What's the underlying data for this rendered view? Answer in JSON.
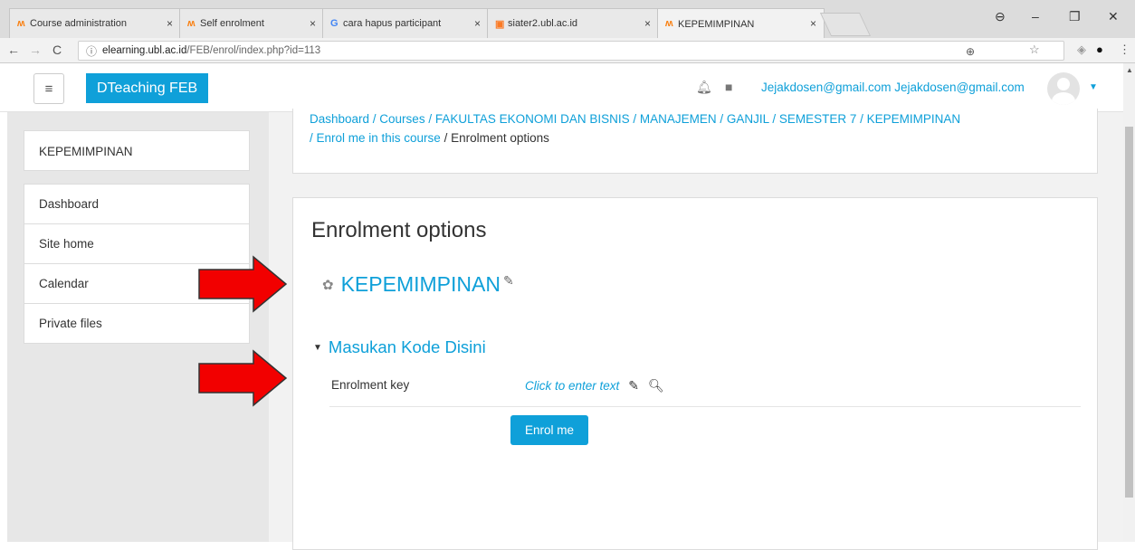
{
  "browser": {
    "tabs": [
      {
        "label": "Course administration",
        "icon": "moodle-icon"
      },
      {
        "label": "Self enrolment",
        "icon": "moodle-icon"
      },
      {
        "label": "cara hapus participant di",
        "icon": "google-icon"
      },
      {
        "label": "siater2.ubl.ac.id",
        "icon": "xampp-icon"
      },
      {
        "label": "KEPEMIMPINAN",
        "icon": "moodle-icon"
      }
    ],
    "address_domain": "elearning.ubl.ac.id",
    "address_path": "/FEB/enrol/index.php?id=113"
  },
  "navbar": {
    "brand": "DTeaching FEB",
    "user": "Jejakdosen@gmail.com Jejakdosen@gmail.com"
  },
  "sidebar": {
    "course": "KEPEMIMPINAN",
    "items": [
      {
        "label": "Dashboard"
      },
      {
        "label": "Site home"
      },
      {
        "label": "Calendar"
      },
      {
        "label": "Private files"
      }
    ]
  },
  "breadcrumb": {
    "line1": "Dashboard / Courses / FAKULTAS EKONOMI DAN BISNIS / MANAJEMEN / GANJIL / SEMESTER 7 / KEPEMIMPINAN",
    "line2_link": "/ Enrol me in this course",
    "line2_current": "/ Enrolment options"
  },
  "main": {
    "heading": "Enrolment options",
    "course_title": "KEPEMIMPINAN",
    "section_title": "Masukan Kode Disini",
    "key_label": "Enrolment key",
    "key_placeholder": "Click to enter text",
    "enrol_button": "Enrol me"
  },
  "colors": {
    "accent": "#0fa0d9",
    "arrow": "#f20000"
  }
}
